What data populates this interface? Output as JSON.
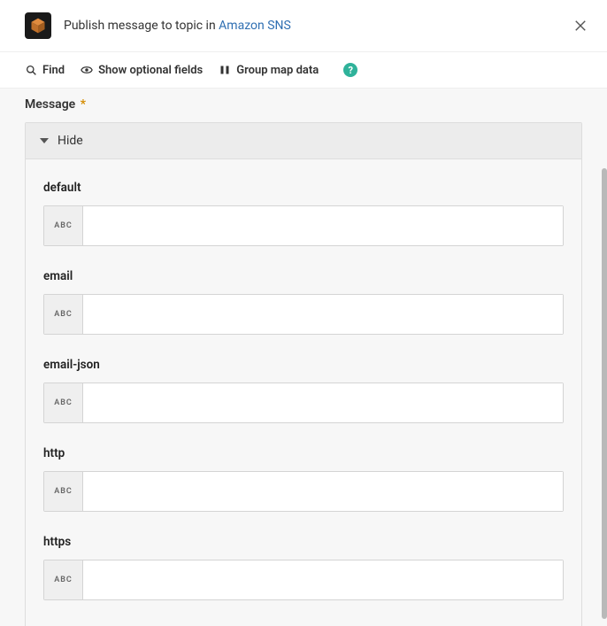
{
  "header": {
    "title_prefix": "Publish message to topic in ",
    "title_link": "Amazon SNS"
  },
  "toolbar": {
    "find": "Find",
    "optional": "Show optional fields",
    "group": "Group map data",
    "help": "?"
  },
  "section": {
    "message_label": "Message",
    "required_mark": "*",
    "hide_label": "Hide"
  },
  "fields": [
    {
      "label": "default",
      "type_badge": "ABC",
      "value": ""
    },
    {
      "label": "email",
      "type_badge": "ABC",
      "value": ""
    },
    {
      "label": "email-json",
      "type_badge": "ABC",
      "value": ""
    },
    {
      "label": "http",
      "type_badge": "ABC",
      "value": ""
    },
    {
      "label": "https",
      "type_badge": "ABC",
      "value": ""
    }
  ]
}
